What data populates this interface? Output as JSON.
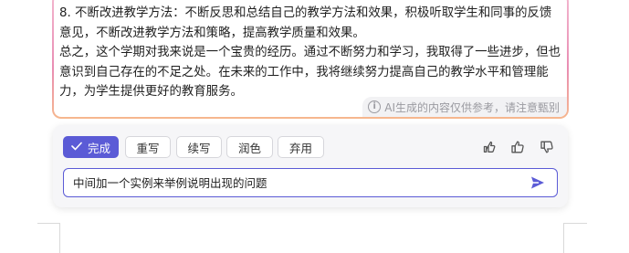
{
  "result": {
    "paragraphs": [
      "8. 不断改进教学方法：不断反思和总结自己的教学方法和效果，积极听取学生和同事的反馈意见，不断改进教学方法和策略，提高教学质量和效果。",
      "总之，这个学期对我来说是一个宝贵的经历。通过不断努力和学习，我取得了一些进步，但也意识到自己存在的不足之处。在未来的工作中，我将继续努力提高自己的教学水平和管理能力，为学生提供更好的教育服务。"
    ],
    "disclaimer": "AI生成的内容仅供参考，请注意甄别"
  },
  "actions": {
    "done_label": "完成",
    "rewrite_label": "重写",
    "continue_label": "续写",
    "polish_label": "润色",
    "discard_label": "弃用"
  },
  "prompt": {
    "value": "中间加一个实例来举例说明出现的问题"
  },
  "colors": {
    "accent": "#5b5bd6",
    "panel_bg": "#f6f6f8"
  }
}
